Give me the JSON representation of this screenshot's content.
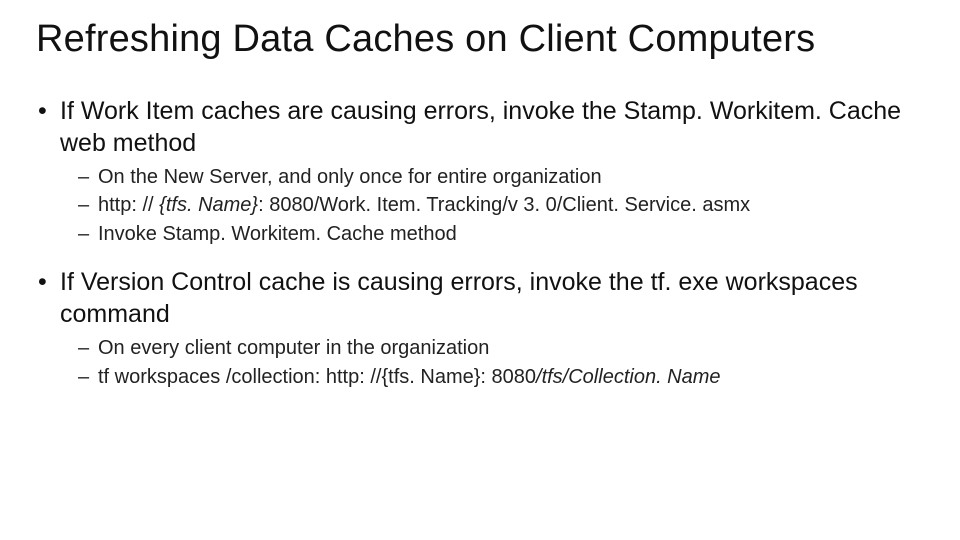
{
  "title": "Refreshing Data Caches on Client Computers",
  "bullets": [
    {
      "text_a": "If Work Item caches are causing errors, invoke the ",
      "text_b": "Stamp. Workitem. Cache",
      "text_c": " web method",
      "subs": [
        {
          "plain": "On the New Server, and only once for entire organization"
        },
        {
          "pre": "http: // ",
          "it": "{tfs. Name}",
          "post": ": 8080/Work. Item. Tracking/v 3. 0/Client. Service. asmx"
        },
        {
          "invoke_a": "Invoke ",
          "invoke_b": "Stamp. Workitem. Cache",
          "invoke_c": " method"
        }
      ]
    },
    {
      "text_a": "If Version Control cache is causing errors, invoke the ",
      "text_b": "tf. exe workspaces",
      "text_c": " command",
      "subs": [
        {
          "on_a": "On ",
          "on_b": "every",
          "on_c": " client computer in the organization"
        },
        {
          "ws_a": "tf workspaces /collection: http: //",
          "ws_b": "{tfs. Name}: 8080",
          "ws_c": "/tfs/Collection. Name"
        }
      ]
    }
  ]
}
